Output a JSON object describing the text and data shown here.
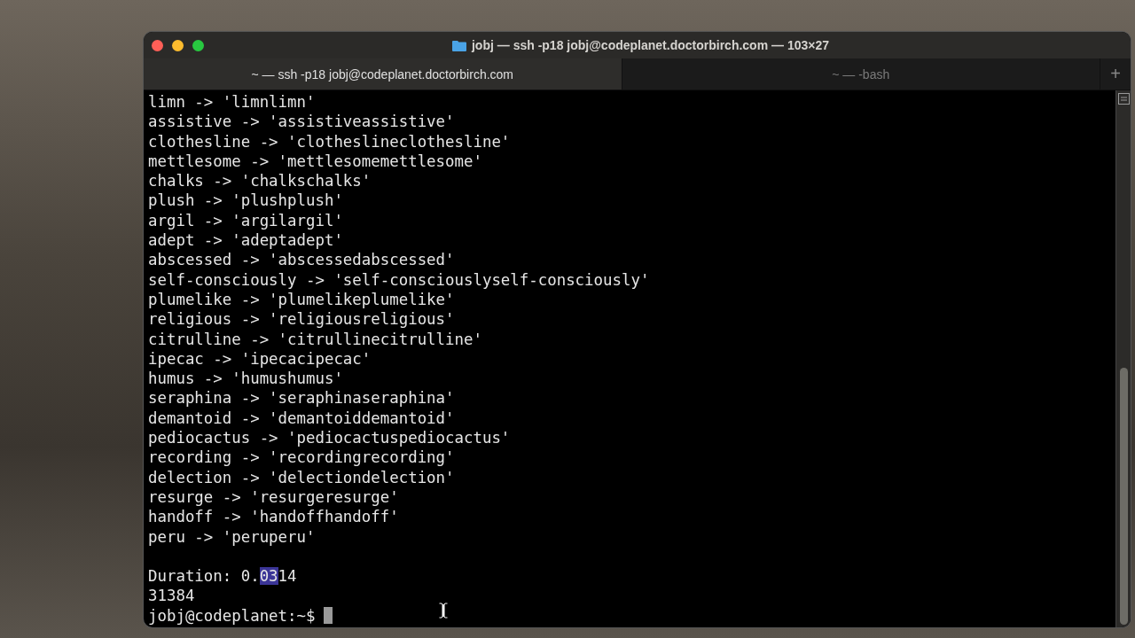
{
  "window": {
    "title": "jobj — ssh -p18 jobj@codeplanet.doctorbirch.com — 103×27"
  },
  "tabs": [
    {
      "label": "~ — ssh -p18 jobj@codeplanet.doctorbirch.com",
      "selected": true
    },
    {
      "label": "~ — -bash",
      "selected": false
    }
  ],
  "new_tab": {
    "label": "+"
  },
  "terminal": {
    "lines": [
      {
        "kind": "output",
        "text": "limn -> 'limnlimn'"
      },
      {
        "kind": "output",
        "text": "assistive -> 'assistiveassistive'"
      },
      {
        "kind": "output",
        "text": "clothesline -> 'clotheslineclothesline'"
      },
      {
        "kind": "output",
        "text": "mettlesome -> 'mettlesomemettlesome'"
      },
      {
        "kind": "output",
        "text": "chalks -> 'chalkschalks'"
      },
      {
        "kind": "output",
        "text": "plush -> 'plushplush'"
      },
      {
        "kind": "output",
        "text": "argil -> 'argilargil'"
      },
      {
        "kind": "output",
        "text": "adept -> 'adeptadept'"
      },
      {
        "kind": "output",
        "text": "abscessed -> 'abscessedabscessed'"
      },
      {
        "kind": "output",
        "text": "self-consciously -> 'self-consciouslyself-consciously'"
      },
      {
        "kind": "output",
        "text": "plumelike -> 'plumelikeplumelike'"
      },
      {
        "kind": "output",
        "text": "religious -> 'religiousreligious'"
      },
      {
        "kind": "output",
        "text": "citrulline -> 'citrullinecitrulline'"
      },
      {
        "kind": "output",
        "text": "ipecac -> 'ipecacipecac'"
      },
      {
        "kind": "output",
        "text": "humus -> 'humushumus'"
      },
      {
        "kind": "output",
        "text": "seraphina -> 'seraphinaseraphina'"
      },
      {
        "kind": "output",
        "text": "demantoid -> 'demantoiddemantoid'"
      },
      {
        "kind": "output",
        "text": "pediocactus -> 'pediocactuspediocactus'"
      },
      {
        "kind": "output",
        "text": "recording -> 'recordingrecording'"
      },
      {
        "kind": "output",
        "text": "delection -> 'delectiondelection'"
      },
      {
        "kind": "output",
        "text": "resurge -> 'resurgeresurge'"
      },
      {
        "kind": "output",
        "text": "handoff -> 'handoffhandoff'"
      },
      {
        "kind": "output",
        "text": "peru -> 'peruperu'"
      },
      {
        "kind": "blank"
      },
      {
        "kind": "parts",
        "parts": [
          {
            "text": "Duration: 0.",
            "selected": false
          },
          {
            "text": "03",
            "selected": true
          },
          {
            "text": "14",
            "selected": false
          }
        ]
      },
      {
        "kind": "output",
        "text": "31384"
      },
      {
        "kind": "prompt",
        "text": "jobj@codeplanet:~$",
        "cursor": true
      }
    ]
  }
}
